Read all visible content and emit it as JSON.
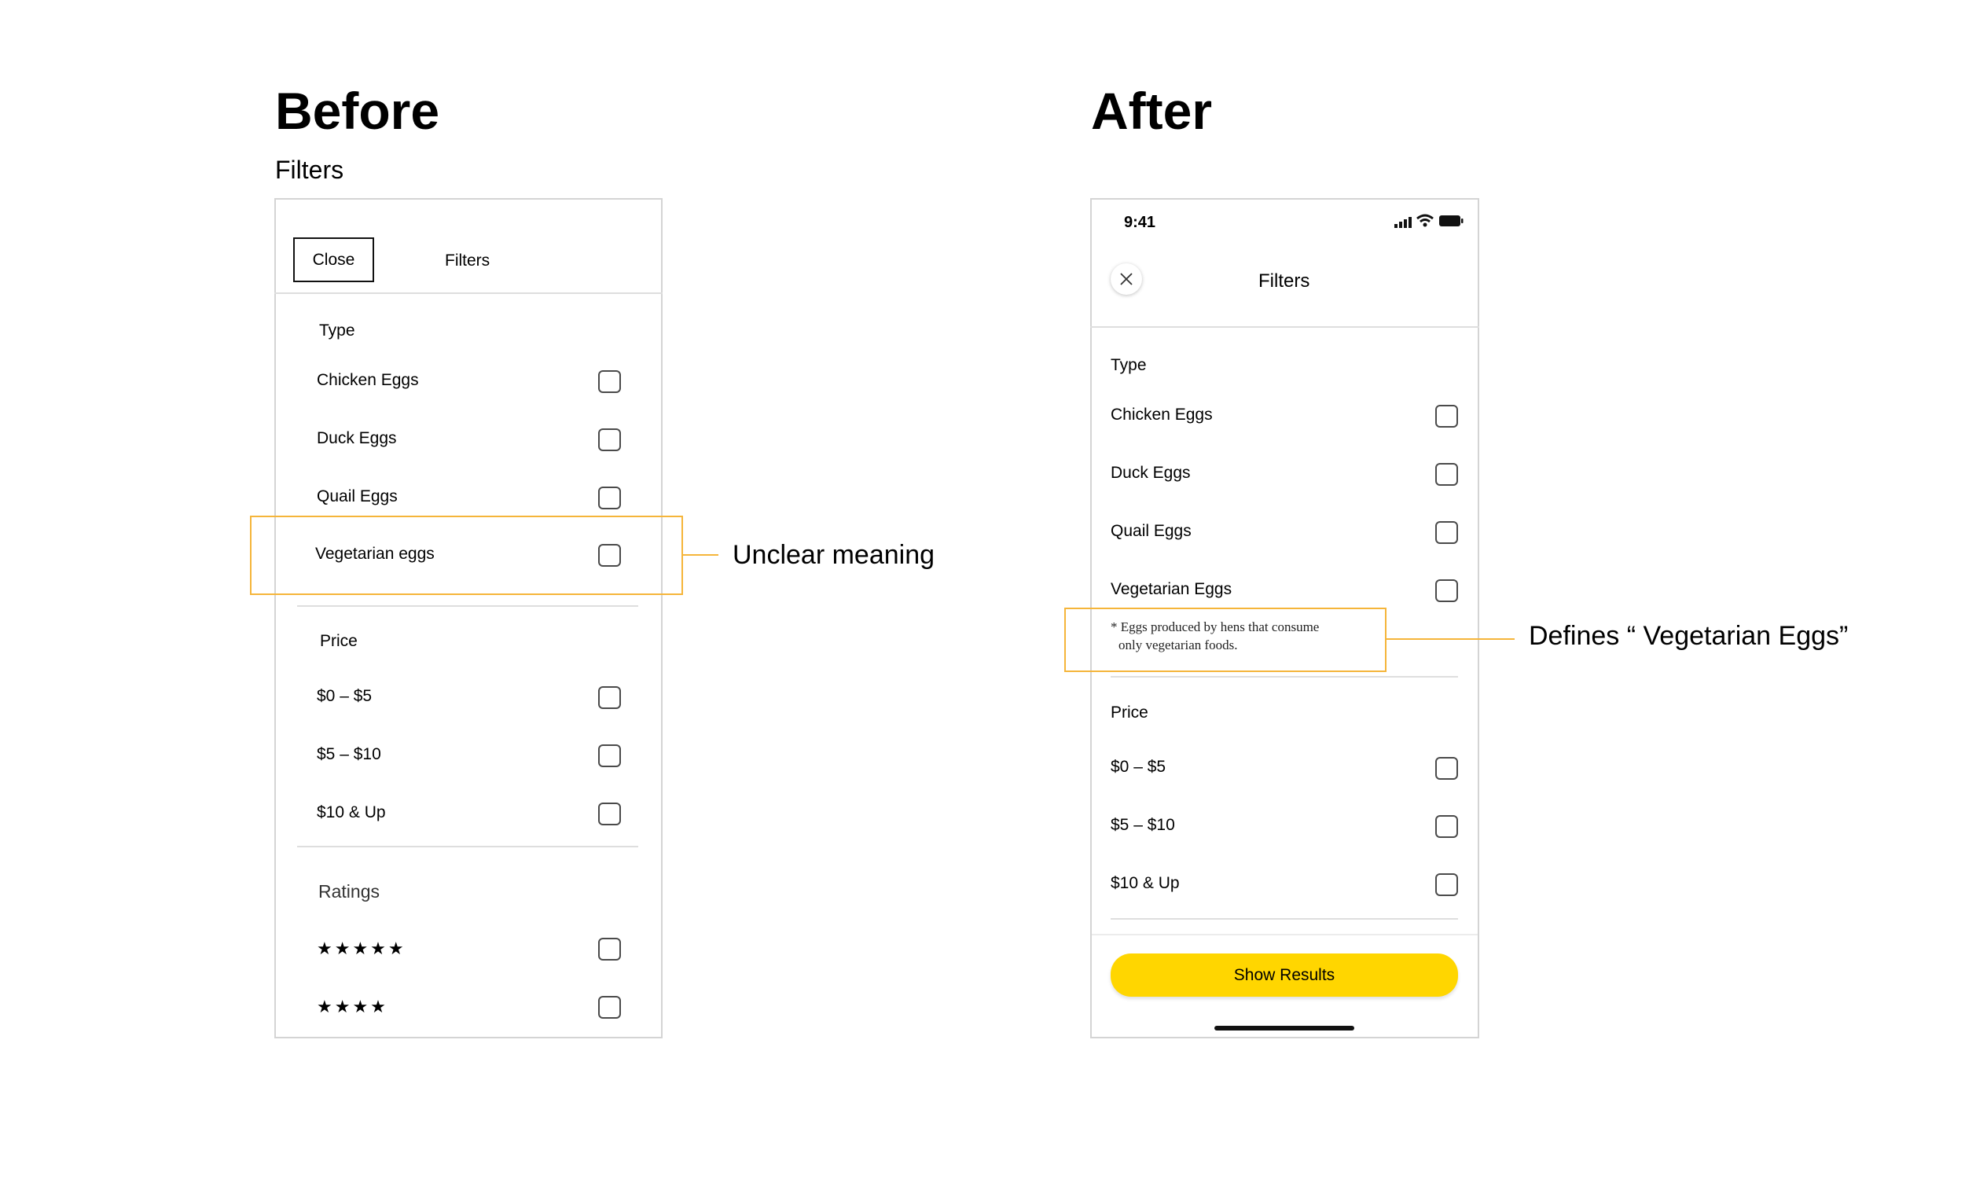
{
  "before": {
    "heading": "Before",
    "subheading": "Filters",
    "header": {
      "close_label": "Close",
      "title": "Filters"
    },
    "type_section": {
      "label": "Type",
      "options": [
        "Chicken Eggs",
        "Duck Eggs",
        "Quail Eggs",
        "Vegetarian eggs"
      ]
    },
    "price_section": {
      "label": "Price",
      "options": [
        "$0 – $5",
        "$5 – $10",
        "$10 & Up"
      ]
    },
    "ratings_section": {
      "label": "Ratings",
      "options": [
        "★★★★★",
        "★★★★"
      ]
    },
    "annotation": "Unclear meaning"
  },
  "after": {
    "heading": "After",
    "status_bar": {
      "time": "9:41"
    },
    "header": {
      "title": "Filters",
      "close_icon": "close-icon"
    },
    "type_section": {
      "label": "Type",
      "options": [
        "Chicken Eggs",
        "Duck Eggs",
        "Quail Eggs",
        "Vegetarian Eggs"
      ],
      "note_line1": "* Eggs produced by hens that consume",
      "note_line2": "only vegetarian foods."
    },
    "price_section": {
      "label": "Price",
      "options": [
        "$0 – $5",
        "$5 – $10",
        "$10 & Up"
      ]
    },
    "show_results_label": "Show Results",
    "annotation": "Defines “ Vegetarian Eggs”"
  },
  "colors": {
    "accent_yellow": "#ffd600",
    "annotation_orange": "#f5b53a",
    "border_gray": "#d4d4d4"
  }
}
